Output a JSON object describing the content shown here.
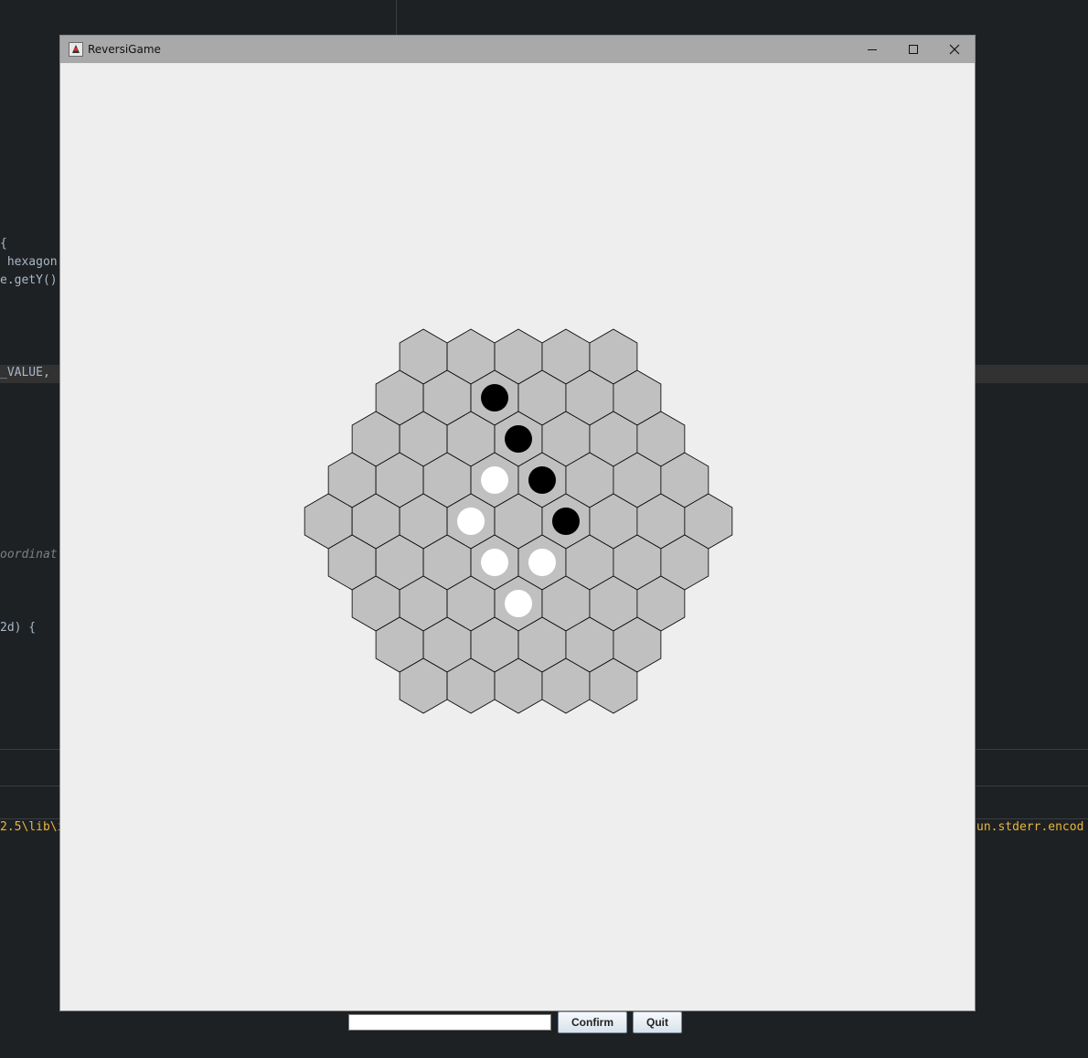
{
  "window": {
    "title": "ReversiGame",
    "icon": "java-duke-icon",
    "controls": [
      "minimize-icon",
      "maximize-icon",
      "close-icon"
    ]
  },
  "background_code": {
    "lines": [
      "{",
      " hexagon",
      "e.getY()",
      "_VALUE,",
      "oordinat",
      "2d) {",
      "2.5\\lib\\i",
      "un.stderr.encod"
    ]
  },
  "board": {
    "shape": "hexagonal",
    "radius": 4,
    "cell_color": "#c0c0c0",
    "grid_color": "#000000",
    "black_color": "#000000",
    "white_color": "#ffffff",
    "discs": [
      {
        "row": 1,
        "col": 2,
        "color": "black"
      },
      {
        "row": 2,
        "col": 3,
        "color": "black"
      },
      {
        "row": 3,
        "col": 3,
        "color": "white"
      },
      {
        "row": 3,
        "col": 4,
        "color": "black"
      },
      {
        "row": 4,
        "col": 3,
        "color": "white"
      },
      {
        "row": 4,
        "col": 5,
        "color": "black"
      },
      {
        "row": 5,
        "col": 3,
        "color": "white"
      },
      {
        "row": 5,
        "col": 4,
        "color": "white"
      },
      {
        "row": 6,
        "col": 3,
        "color": "white"
      }
    ]
  },
  "controls": {
    "input_value": "",
    "confirm_label": "Confirm",
    "quit_label": "Quit"
  }
}
